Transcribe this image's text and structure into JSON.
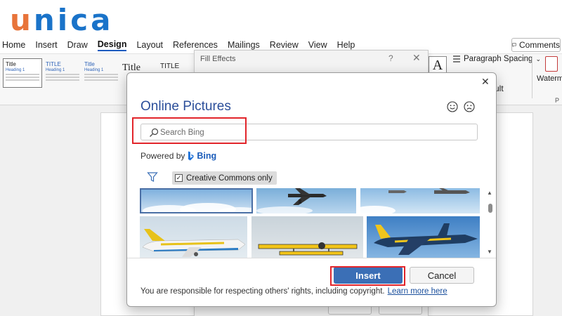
{
  "logo": {
    "first_letter": "u",
    "rest": "nica"
  },
  "ribbon": {
    "tabs": [
      {
        "label": "Home"
      },
      {
        "label": "Insert"
      },
      {
        "label": "Draw"
      },
      {
        "label": "Design",
        "active": true
      },
      {
        "label": "Layout"
      },
      {
        "label": "References"
      },
      {
        "label": "Mailings"
      },
      {
        "label": "Review"
      },
      {
        "label": "View"
      },
      {
        "label": "Help"
      }
    ],
    "comments_label": "Comments",
    "themes": {
      "thumb1_title": "Title",
      "thumb1_heading": "Heading 1",
      "thumb2_title": "TITLE",
      "thumb2_heading": "Heading 1",
      "thumb3_title": "Title",
      "thumb3_heading": "Heading 1",
      "big_title_1": "Title",
      "big_title_2": "TITLE"
    },
    "paragraph_spacing_label": "Paragraph Spacing",
    "partial_label": "ult",
    "watermark_label": "Waterma",
    "group_partial": "P"
  },
  "fill_effects": {
    "title": "Fill Effects",
    "help": "?",
    "close": "✕"
  },
  "online_pictures": {
    "close": "✕",
    "title": "Online Pictures",
    "search": {
      "placeholder": "Search Bing",
      "value": ""
    },
    "powered_by": "Powered by",
    "bing_label": "Bing",
    "creative_commons_label": "Creative Commons only",
    "creative_commons_checked": true,
    "insert_label": "Insert",
    "cancel_label": "Cancel",
    "notice_text": "You are responsible for respecting others' rights, including copyright.",
    "learn_more_label": "Learn more here"
  },
  "colors": {
    "accent_blue": "#2b4e9a",
    "insert_button": "#3b6fb6",
    "highlight_red": "#e2252b",
    "logo_orange": "#e8743a",
    "logo_blue": "#1a73c9"
  },
  "icons": [
    "smile-icon",
    "frown-icon",
    "search-icon",
    "filter-icon",
    "checkbox-icon",
    "close-icon",
    "bing-logo-icon",
    "comment-icon",
    "watermark-icon"
  ]
}
